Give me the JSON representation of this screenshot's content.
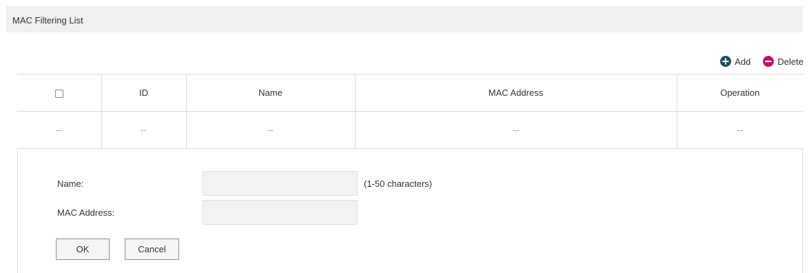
{
  "section": {
    "title": "MAC Filtering List"
  },
  "toolbar": {
    "add_label": "Add",
    "delete_label": "Delete",
    "add_icon": "plus-circle-icon",
    "delete_icon": "minus-circle-icon",
    "add_color": "#1d4f5e",
    "delete_color": "#c0126e"
  },
  "table": {
    "columns": [
      "ID",
      "Name",
      "MAC Address",
      "Operation"
    ],
    "rows": [
      {
        "id": "--",
        "name": "--",
        "mac": "--",
        "operation": "--",
        "checkbox": "--"
      }
    ]
  },
  "form": {
    "name_label": "Name:",
    "name_value": "",
    "name_hint": "(1-50 characters)",
    "mac_label": "MAC Address:",
    "mac_value": "",
    "ok_label": "OK",
    "cancel_label": "Cancel"
  }
}
